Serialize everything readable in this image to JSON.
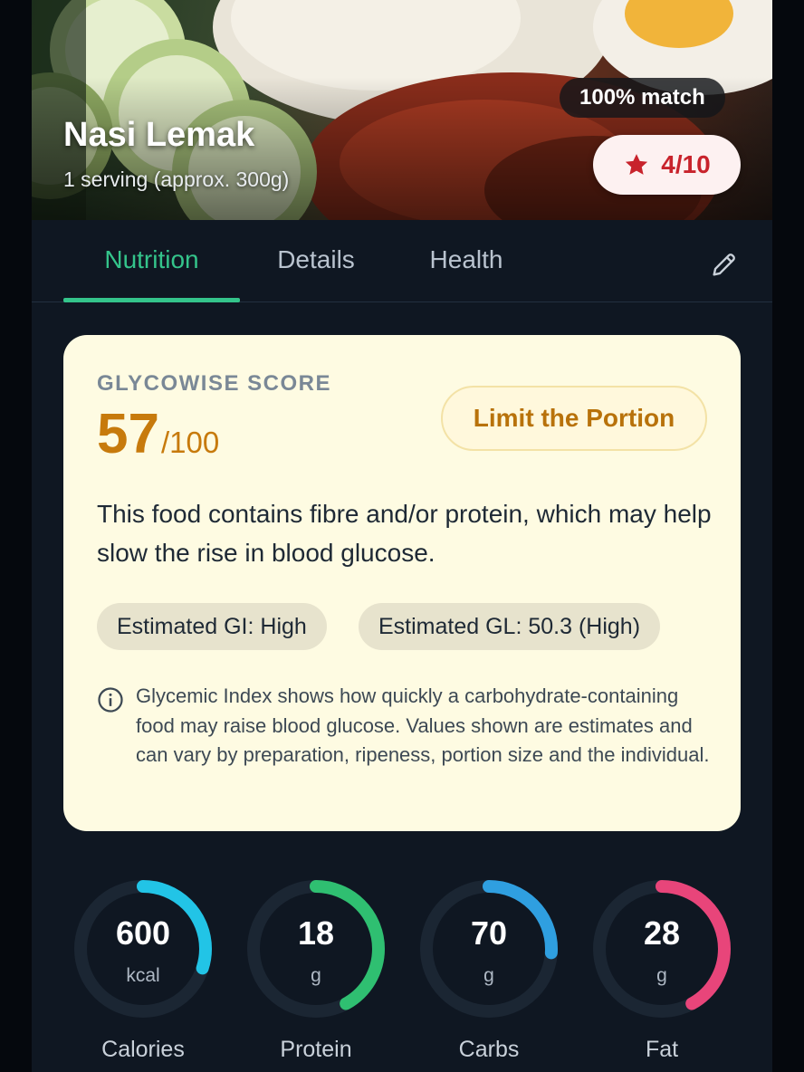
{
  "food": {
    "name": "Nasi Lemak",
    "serving": "1 serving (approx. 300g)",
    "match": "100% match",
    "rating": "4/10",
    "rating_color": "#c8232c"
  },
  "tabs": [
    {
      "label": "Nutrition",
      "active": true
    },
    {
      "label": "Details",
      "active": false
    },
    {
      "label": "Health",
      "active": false
    }
  ],
  "toolbar": {
    "edit_icon": "pencil-icon"
  },
  "glycowise": {
    "label": "GLYCOWISE SCORE",
    "score": "57",
    "max": "/100",
    "action_label": "Limit the Portion",
    "description": "This food contains fibre and/or protein, which may help slow the rise in blood glucose.",
    "chips": [
      "Estimated GI: High",
      "Estimated GL: 50.3 (High)"
    ],
    "info_icon": "info-icon",
    "info_text": "Glycemic Index shows how quickly a carbohydrate-containing food may raise blood glucose. Values shown are estimates and can vary by preparation, ripeness, portion size and the individual.",
    "card_color": "#fefbe2",
    "accent_color": "#c77a0c"
  },
  "macros": [
    {
      "value": "600",
      "unit": "kcal",
      "label": "Calories",
      "fraction": 0.3,
      "color": "#22c4e6"
    },
    {
      "value": "18",
      "unit": "g",
      "label": "Protein",
      "fraction": 0.42,
      "color": "#2fbf71"
    },
    {
      "value": "70",
      "unit": "g",
      "label": "Carbs",
      "fraction": 0.26,
      "color": "#2f9fe0"
    },
    {
      "value": "28",
      "unit": "g",
      "label": "Fat",
      "fraction": 0.42,
      "color": "#e8457a"
    }
  ],
  "colors": {
    "background": "#0f1722",
    "tab_active": "#34c48b",
    "tab_inactive": "#b9c3cf"
  }
}
